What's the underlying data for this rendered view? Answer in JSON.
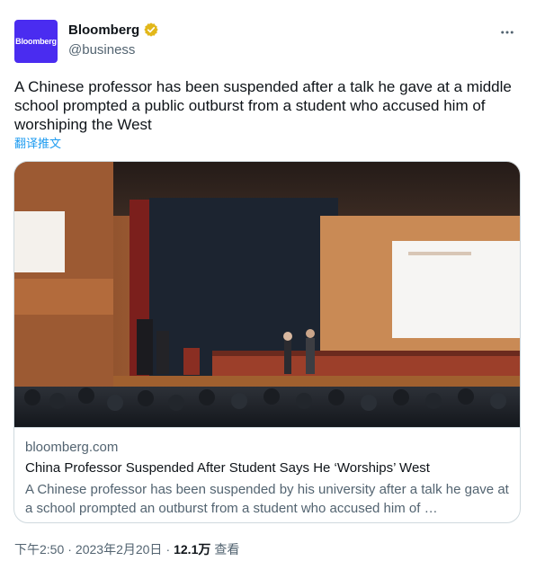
{
  "author": {
    "avatar_text": "Bloomberg",
    "avatar_color": "#4a2cf0",
    "display_name": "Bloomberg",
    "handle": "@business",
    "verified_badge": "gold-verified-icon"
  },
  "more_icon": "more-dots-icon",
  "tweet": {
    "text": "A Chinese professor has been suspended after a talk he gave at a middle school prompted a public outburst from a student who accused him of worshiping the West",
    "translate_label": "翻译推文"
  },
  "card": {
    "domain": "bloomberg.com",
    "title": "China Professor Suspended After Student Says He ‘Worships’ West",
    "description": "A Chinese professor has been suspended by his university after a talk he gave at a school prompted an outburst from a student who accused him of …"
  },
  "meta": {
    "time": "下午2:50",
    "separator": "·",
    "date": "2023年2月20日",
    "views_count": "12.1万",
    "views_label": "查看"
  },
  "colors": {
    "link": "#1d9bf0",
    "secondary_text": "#536471",
    "border": "#cfd9de"
  }
}
